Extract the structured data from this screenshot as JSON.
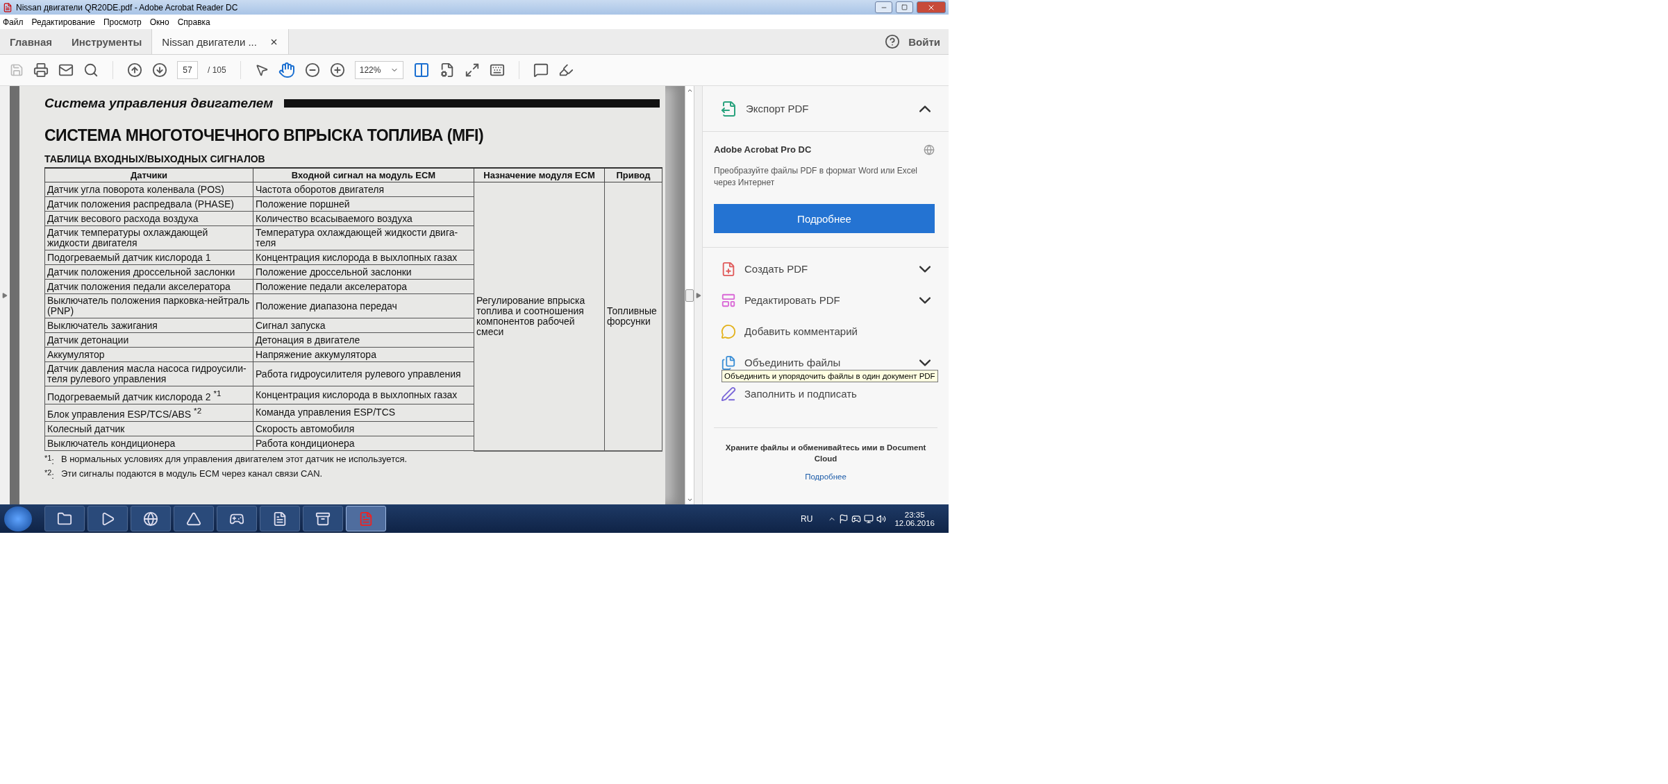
{
  "window": {
    "title": "Nissan двигатели QR20DE.pdf - Adobe Acrobat Reader DC"
  },
  "menu": [
    "Файл",
    "Редактирование",
    "Просмотр",
    "Окно",
    "Справка"
  ],
  "tabs": [
    {
      "label": "Главная",
      "selected": false,
      "closable": false
    },
    {
      "label": "Инструменты",
      "selected": false,
      "closable": false
    },
    {
      "label": "Nissan двигатели ...",
      "selected": true,
      "closable": true
    }
  ],
  "sign_in": "Войти",
  "toolbar": {
    "page": "57",
    "page_count": "/  105",
    "zoom": "122%"
  },
  "document": {
    "running_head": "Система управления двигателем",
    "title": "СИСТЕМА МНОГОТОЧЕЧНОГО ВПРЫСКА ТОПЛИВА (MFI)",
    "subtitle": "ТАБЛИЦА ВХОДНЫХ/ВЫХОДНЫХ СИГНАЛОВ",
    "columns": [
      "Датчики",
      "Входной сигнал на модуль ECM",
      "Назначение модуля ECM",
      "Привод"
    ],
    "rows": [
      {
        "sensor": "Датчик угла поворота коленвала (POS)",
        "signal": "Частота оборотов двигателя"
      },
      {
        "sensor": "Датчик положения распредвала (PHASE)",
        "signal": "Положение поршней"
      },
      {
        "sensor": "Датчик весового расхода воздуха",
        "signal": "Количество всасываемого воздуха"
      },
      {
        "sensor": "Датчик температуры охлаждающей жидкости двигателя",
        "signal": "Температура охлаждающей жидкости двига-теля"
      },
      {
        "sensor": "Подогреваемый датчик кислорода 1",
        "signal": "Концентрация кислорода в выхлопных газах"
      },
      {
        "sensor": "Датчик положения  дроссельной заслонки",
        "signal": "Положение дроссельной заслонки"
      },
      {
        "sensor": "Датчик положения педали акселератора",
        "signal": "Положение педали акселератора"
      },
      {
        "sensor": "Выключатель положения парковка-нейтраль (PNP)",
        "signal": "Положение диапазона передач"
      },
      {
        "sensor": "Выключатель зажигания",
        "signal": "Сигнал запуска"
      },
      {
        "sensor": "Датчик детонации",
        "signal": "Детонация в двигателе"
      },
      {
        "sensor": "Аккумулятор",
        "signal": "Напряжение аккумулятора"
      },
      {
        "sensor": "Датчик давления масла насоса гидроусили-теля рулевого управления",
        "signal": "Работа гидроусилителя рулевого управления"
      },
      {
        "sensor": "Подогреваемый датчик кислорода 2 $^{*1}$",
        "signal": "Концентрация кислорода в выхлопных газах"
      },
      {
        "sensor": "Блок управления ESP/TCS/ABS $^{*2}$",
        "signal": "Команда управления ESP/TCS"
      },
      {
        "sensor": "Колесный датчик",
        "signal": "Скорость автомобиля"
      },
      {
        "sensor": "Выключатель кондиционера",
        "signal": "Работа кондиционера"
      }
    ],
    "purpose": "Регулирование впрыска топлива и соотношения компонентов рабочей смеси",
    "actuator": "Топливные форсунки",
    "footnotes": [
      {
        "mark": "$^{*1}$:",
        "text": "В нормальных условиях для управления двигателем этот датчик не используется."
      },
      {
        "mark": "$^{*2}$:",
        "text": "Эти сигналы подаются в модуль ECM через канал связи CAN."
      }
    ]
  },
  "panel": {
    "export": {
      "label": "Экспорт PDF",
      "expanded": true,
      "product": "Adobe Acrobat Pro DC",
      "description": "Преобразуйте файлы PDF в формат Word или Excel через Интернет",
      "button": "Подробнее"
    },
    "tools": [
      {
        "label": "Создать PDF",
        "kind": "expandable",
        "expanded": false
      },
      {
        "label": "Редактировать PDF",
        "kind": "expandable",
        "expanded": false
      },
      {
        "label": "Добавить комментарий",
        "kind": "plain"
      },
      {
        "label": "Объединить файлы",
        "kind": "expandable",
        "expanded": false
      },
      {
        "label": "Заполнить и подписать",
        "kind": "plain"
      }
    ],
    "tooltip": "Объединить и упорядочить файлы в один документ PDF",
    "cloud_text": "Храните файлы и обменивайтесь ими в Document Cloud",
    "cloud_link": "Подробнее"
  },
  "taskbar": {
    "apps": [
      {
        "selected": false
      },
      {
        "selected": false
      },
      {
        "selected": false
      },
      {
        "selected": false
      },
      {
        "selected": false
      },
      {
        "selected": false
      },
      {
        "selected": false
      },
      {
        "selected": true
      }
    ],
    "language": "RU",
    "time": "23:35",
    "date": "12.06.2016"
  }
}
